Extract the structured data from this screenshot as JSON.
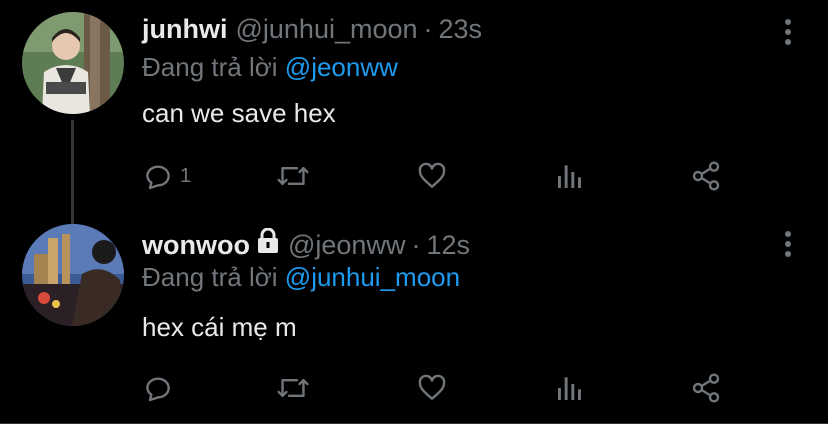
{
  "tweets": [
    {
      "name": "junhwi",
      "handle": "@junhui_moon",
      "dot": "·",
      "time": "23s",
      "reply_prefix": "Đang trả lời",
      "reply_to": "@jeonww",
      "text": "can we save hex",
      "reply_count": "1",
      "icons": [
        "reply-icon",
        "retweet-icon",
        "like-icon",
        "views-icon",
        "share-icon",
        "more-icon"
      ]
    },
    {
      "name": "wonwoo",
      "handle": "@jeonww",
      "dot": "·",
      "time": "12s",
      "reply_prefix": "Đang trả lời",
      "reply_to": "@junhui_moon",
      "text": "hex cái mẹ m",
      "reply_count": "",
      "protected": true,
      "icons": [
        "reply-icon",
        "retweet-icon",
        "like-icon",
        "views-icon",
        "share-icon",
        "more-icon"
      ]
    }
  ],
  "colors": {
    "background": "#000000",
    "text": "#e7e9ea",
    "muted": "#71767b",
    "accent": "#1d9bf0"
  }
}
